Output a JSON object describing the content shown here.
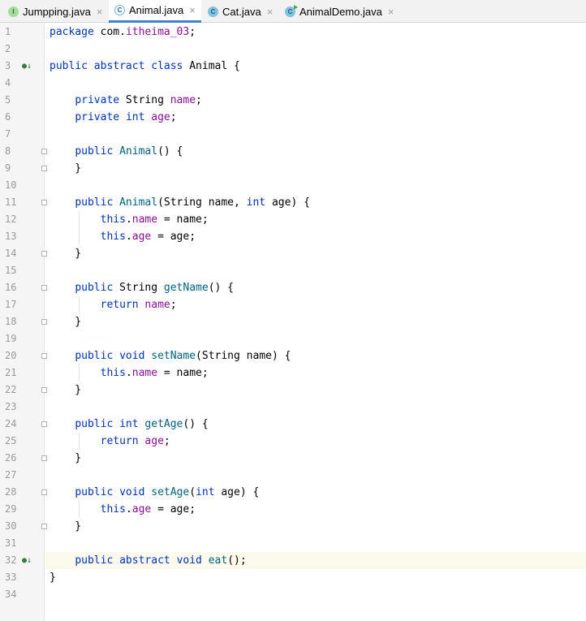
{
  "tabs": [
    {
      "label": "Jumpping.java",
      "icon": "interface-icon",
      "glyph": "I",
      "active": false
    },
    {
      "label": "Animal.java",
      "icon": "abstract-class-icon",
      "glyph": "C",
      "active": true
    },
    {
      "label": "Cat.java",
      "icon": "class-icon",
      "glyph": "C",
      "active": false
    },
    {
      "label": "AnimalDemo.java",
      "icon": "runnable-class-icon",
      "glyph": "C",
      "active": false
    }
  ],
  "close_glyph": "×",
  "lines": [
    "package com.itheima_03;",
    "",
    "public abstract class Animal {",
    "",
    "    private String name;",
    "    private int age;",
    "",
    "    public Animal() {",
    "    }",
    "",
    "    public Animal(String name, int age) {",
    "        this.name = name;",
    "        this.age = age;",
    "    }",
    "",
    "    public String getName() {",
    "        return name;",
    "    }",
    "",
    "    public void setName(String name) {",
    "        this.name = name;",
    "    }",
    "",
    "    public int getAge() {",
    "        return age;",
    "    }",
    "",
    "    public void setAge(int age) {",
    "        this.age = age;",
    "    }",
    "",
    "    public abstract void eat();",
    "}",
    ""
  ],
  "line_numbers": [
    "1",
    "2",
    "3",
    "4",
    "5",
    "6",
    "7",
    "8",
    "9",
    "10",
    "11",
    "12",
    "13",
    "14",
    "15",
    "16",
    "17",
    "18",
    "19",
    "20",
    "21",
    "22",
    "23",
    "24",
    "25",
    "26",
    "27",
    "28",
    "29",
    "30",
    "31",
    "32",
    "33",
    "34"
  ],
  "caret_line": 32,
  "markers": [
    {
      "line": 3,
      "icon": "implemented-down-icon"
    },
    {
      "line": 32,
      "icon": "implemented-down-icon"
    }
  ],
  "colors": {
    "keyword": "#0033b3",
    "field": "#871094",
    "method": "#00627a",
    "tab_underline": "#4083c9"
  }
}
